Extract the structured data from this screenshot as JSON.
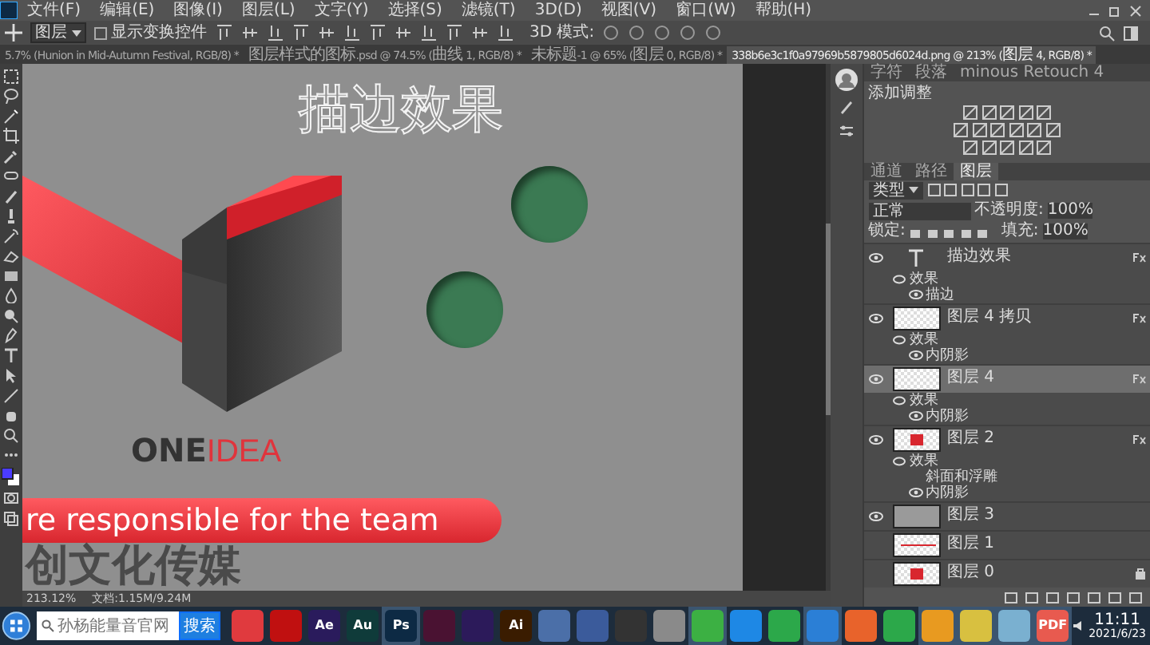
{
  "menu": [
    "文件(F)",
    "编辑(E)",
    "图像(I)",
    "图层(L)",
    "文字(Y)",
    "选择(S)",
    "滤镜(T)",
    "3D(D)",
    "视图(V)",
    "窗口(W)",
    "帮助(H)"
  ],
  "options_bar": {
    "target": "图层",
    "show_transform": {
      "label": "显示变换控件",
      "checked": false
    },
    "mode_label": "3D 模式:"
  },
  "tabs": [
    {
      "label": "5.7% (Hunion in Mid-Autumn Festival, RGB/8) *",
      "selected": false
    },
    {
      "label": "图层样式的图标.psd @ 74.5% (曲线 1, RGB/8) *",
      "selected": false
    },
    {
      "label": "未标题-1 @ 65% (图层 0, RGB/8) *",
      "selected": false
    },
    {
      "label": "338b6e3c1f0a97969b5879805d6024d.png @ 213% (图层 4, RGB/8) *",
      "selected": true
    }
  ],
  "canvas": {
    "outline_title": "描边效果",
    "logo_one": "ONE",
    "logo_idea": "IDEA",
    "tagline": "re responsible for the team",
    "banner_text": "创文化传媒"
  },
  "status_bar": {
    "zoom": "213.12%",
    "doc": "文档:1.15M/9.24M"
  },
  "adjust_panel": {
    "tabs": [
      {
        "label": "字符",
        "selected": false
      },
      {
        "label": "段落",
        "selected": false
      },
      {
        "label": "minous Retouch 4",
        "selected": false
      }
    ],
    "title": "添加调整"
  },
  "layers_panel": {
    "tabs": [
      {
        "label": "通道",
        "selected": false
      },
      {
        "label": "路径",
        "selected": false
      },
      {
        "label": "图层",
        "selected": true
      }
    ],
    "filter": "类型",
    "blend_mode": "正常",
    "opacity_label": "不透明度:",
    "opacity": "100%",
    "lock_label": "锁定:",
    "fill_label": "填充:",
    "fill": "100%",
    "layers": [
      {
        "name": "描边效果",
        "kind": "text",
        "visible": true,
        "selected": false,
        "fx": true,
        "effects": {
          "label": "效果",
          "items": [
            {
              "name": "描边",
              "visible": true
            }
          ]
        }
      },
      {
        "name": "图层 4 拷贝",
        "kind": "transparent",
        "visible": true,
        "selected": false,
        "fx": true,
        "effects": {
          "label": "效果",
          "items": [
            {
              "name": "内阴影",
              "visible": true
            }
          ]
        }
      },
      {
        "name": "图层 4",
        "kind": "transparent",
        "visible": true,
        "selected": true,
        "fx": true,
        "effects": {
          "label": "效果",
          "items": [
            {
              "name": "内阴影",
              "visible": true
            }
          ]
        }
      },
      {
        "name": "图层 2",
        "kind": "logo",
        "visible": true,
        "selected": false,
        "fx": true,
        "effects": {
          "label": "效果",
          "items": [
            {
              "name": "斜面和浮雕",
              "visible": false
            },
            {
              "name": "内阴影",
              "visible": true
            }
          ]
        }
      },
      {
        "name": "图层 3",
        "kind": "fill",
        "visible": true,
        "selected": false,
        "fx": false
      },
      {
        "name": "图层 1",
        "kind": "line",
        "visible": false,
        "selected": false,
        "fx": false
      },
      {
        "name": "图层 0",
        "kind": "logo",
        "visible": false,
        "selected": false,
        "fx": false,
        "locked": true
      }
    ]
  },
  "taskbar": {
    "search_placeholder": "孙杨能量音官网",
    "search_button": "搜索",
    "apps": [
      {
        "color": "#e03a3e",
        "active": false
      },
      {
        "color": "#c01010",
        "active": false
      },
      {
        "label": "Ae",
        "color": "#2a1b5c",
        "active": false
      },
      {
        "label": "Au",
        "color": "#0f3b3a",
        "active": false
      },
      {
        "label": "Ps",
        "color": "#0d2a44",
        "active": true
      },
      {
        "color": "#4a1232",
        "active": false
      },
      {
        "color": "#2c1a5a",
        "active": false
      },
      {
        "label": "Ai",
        "color": "#3a1c00",
        "active": false
      },
      {
        "color": "#4b6fa8",
        "active": false
      },
      {
        "color": "#3b5b9b",
        "active": false
      },
      {
        "color": "#333333",
        "active": false
      },
      {
        "color": "#8a8a8a",
        "active": false
      },
      {
        "color": "#3cb043",
        "active": true
      },
      {
        "color": "#1e88e5",
        "active": false
      },
      {
        "color": "#2ca84a",
        "active": false
      },
      {
        "color": "#2b7fd6",
        "active": true
      },
      {
        "color": "#e8632b",
        "active": false
      },
      {
        "color": "#2ca84a",
        "active": false
      },
      {
        "color": "#e89a20",
        "active": true
      },
      {
        "color": "#d8c040",
        "active": true
      },
      {
        "color": "#7ab0d0",
        "active": true
      },
      {
        "label": "PDF",
        "color": "#e85a4f",
        "active": true
      }
    ],
    "time": "11:11",
    "date": "2021/6/23"
  }
}
